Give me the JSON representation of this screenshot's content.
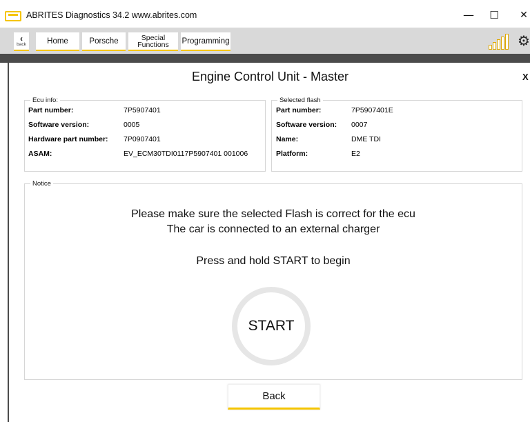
{
  "window": {
    "title": "ABRITES Diagnostics 34.2   www.abrites.com",
    "minimize_glyph": "—",
    "maximize_glyph": "☐",
    "close_glyph": "✕"
  },
  "toolbar": {
    "back_label": "back",
    "buttons": [
      "Home",
      "Porsche",
      "Special Functions",
      "Programming"
    ],
    "special_line1": "Special",
    "special_line2": "Functions",
    "accent_color": "#f5c400"
  },
  "dialog": {
    "title": "Engine Control Unit - Master",
    "close_label": "X",
    "ecu_info": {
      "legend": "Ecu info:",
      "rows": [
        {
          "label": "Part number:",
          "value": "7P5907401"
        },
        {
          "label": "Software version:",
          "value": "0005"
        },
        {
          "label": "Hardware part number:",
          "value": "7P0907401"
        },
        {
          "label": "ASAM:",
          "value": "EV_ECM30TDI0117P5907401 001006"
        }
      ]
    },
    "selected_flash": {
      "legend": "Selected flash",
      "rows": [
        {
          "label": "Part number:",
          "value": "7P5907401E"
        },
        {
          "label": "Software version:",
          "value": "0007"
        },
        {
          "label": "Name:",
          "value": "DME TDI"
        },
        {
          "label": "Platform:",
          "value": "E2"
        }
      ]
    },
    "notice": {
      "legend": "Notice",
      "line1": "Please make sure the selected Flash is correct for the ecu",
      "line2": "The car is connected to an external charger",
      "line3": "Press and hold START to begin"
    },
    "start_label": "START",
    "back_button": "Back"
  }
}
